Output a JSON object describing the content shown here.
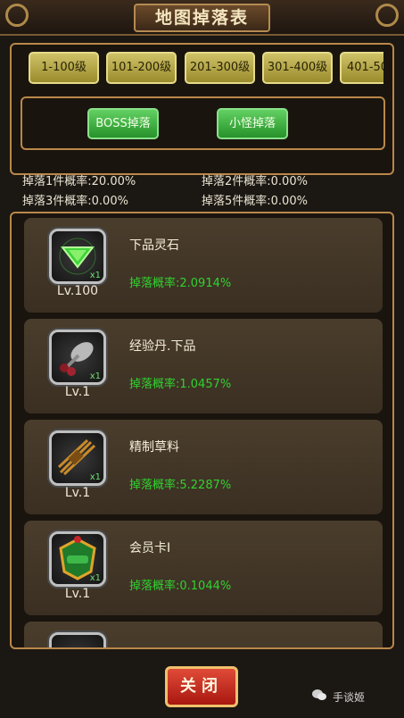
{
  "header": {
    "title": "地图掉落表"
  },
  "level_tabs": [
    "1-100级",
    "101-200级",
    "201-300级",
    "301-400级",
    "401-50"
  ],
  "type_buttons": {
    "boss": "BOSS掉落",
    "minion": "小怪掉落"
  },
  "rates": [
    "掉落1件概率:20.00%",
    "掉落2件概率:0.00%",
    "掉落3件概率:0.00%",
    "掉落5件概率:0.00%"
  ],
  "items": [
    {
      "name": "下品灵石",
      "level": "Lv.100",
      "qty": "x1",
      "rate": "掉落概率:2.0914%",
      "icon": "green-gem-icon"
    },
    {
      "name": "经验丹.下品",
      "level": "Lv.1",
      "qty": "x1",
      "rate": "掉落概率:1.0457%",
      "icon": "exp-pill-icon"
    },
    {
      "name": "精制草料",
      "level": "Lv.1",
      "qty": "x1",
      "rate": "掉落概率:5.2287%",
      "icon": "hay-bundle-icon"
    },
    {
      "name": "会员卡I",
      "level": "Lv.1",
      "qty": "x1",
      "rate": "掉落概率:0.1044%",
      "icon": "vip-badge-icon"
    }
  ],
  "footer": {
    "close_label": "关闭",
    "watermark": "手谈姬"
  }
}
